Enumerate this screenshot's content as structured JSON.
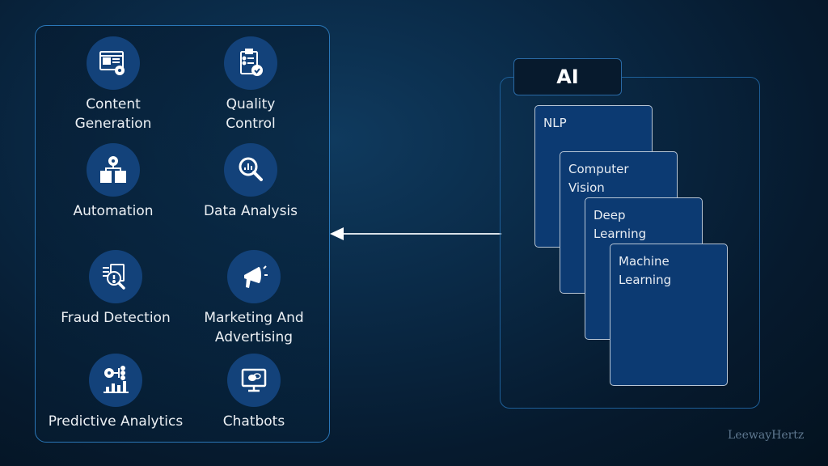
{
  "left_panel": {
    "applications": [
      {
        "label": "Content\nGeneration",
        "icon": "content-generation-icon"
      },
      {
        "label": "Quality\nControl",
        "icon": "quality-control-icon"
      },
      {
        "label": "Automation",
        "icon": "automation-icon"
      },
      {
        "label": "Data Analysis",
        "icon": "data-analysis-icon"
      },
      {
        "label": "Fraud Detection",
        "icon": "fraud-detection-icon"
      },
      {
        "label": "Marketing And\nAdvertising",
        "icon": "marketing-megaphone-icon"
      },
      {
        "label": "Predictive Analytics",
        "icon": "predictive-analytics-icon"
      },
      {
        "label": "Chatbots",
        "icon": "chatbot-monitor-icon"
      }
    ]
  },
  "ai_panel": {
    "title": "AI",
    "layers": [
      {
        "label": "NLP"
      },
      {
        "label": "Computer\nVision"
      },
      {
        "label": "Deep\nLearning"
      },
      {
        "label": "Machine\nLearning"
      }
    ]
  },
  "arrow": {
    "direction": "left",
    "meaning": "AI powers applications"
  },
  "watermark": "LeewayHertz",
  "colors": {
    "background": "#061a2e",
    "panel_border": "#2a77b8",
    "icon_circle": "#13427a",
    "card_fill": "#0c3a72",
    "card_border": "#b8c6d6"
  }
}
